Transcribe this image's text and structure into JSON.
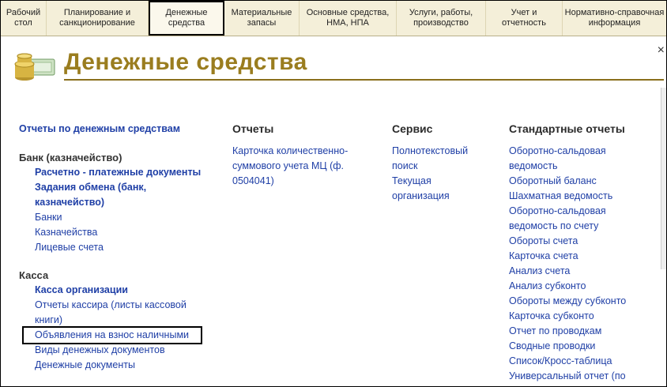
{
  "tabs": [
    {
      "label": "Рабочий\nстол"
    },
    {
      "label": "Планирование и\nсанкционирование"
    },
    {
      "label": "Денежные\nсредства"
    },
    {
      "label": "Материальные\nзапасы"
    },
    {
      "label": "Основные средства,\nНМА, НПА"
    },
    {
      "label": "Услуги, работы,\nпроизводство"
    },
    {
      "label": "Учет и\nотчетность"
    },
    {
      "label": "Нормативно-справочная\nинформация"
    }
  ],
  "page": {
    "title": "Денежные средства",
    "close_glyph": "×"
  },
  "icons": {
    "section_icon": "coins-money-icon"
  },
  "left": {
    "reports_link": "Отчеты по денежным средствам",
    "bank": {
      "header": "Банк (казначейство)",
      "items": [
        "Расчетно - платежные документы",
        "Задания обмена (банк, казначейство)",
        "Банки",
        "Казначейства",
        "Лицевые счета"
      ]
    },
    "cash": {
      "header": "Касса",
      "items": [
        "Касса организации",
        "Отчеты кассира (листы кассовой книги)",
        "Объявления на взнос наличными",
        "Виды денежных документов",
        "Денежные документы"
      ]
    }
  },
  "reports": {
    "header": "Отчеты",
    "items": [
      "Карточка количественно-суммового учета МЦ (ф. 0504041)"
    ]
  },
  "service": {
    "header": "Сервис",
    "items": [
      "Полнотекстовый поиск",
      "Текущая организация"
    ]
  },
  "standard": {
    "header": "Стандартные отчеты",
    "items": [
      "Оборотно-сальдовая ведомость",
      "Оборотный баланс",
      "Шахматная ведомость",
      "Оборотно-сальдовая ведомость по счету",
      "Обороты счета",
      "Карточка счета",
      "Анализ счета",
      "Анализ субконто",
      "Обороты между субконто",
      "Карточка субконто",
      "Отчет по проводкам",
      "Сводные проводки",
      "Список/Кросс-таблица",
      "Универсальный отчет (по"
    ]
  }
}
